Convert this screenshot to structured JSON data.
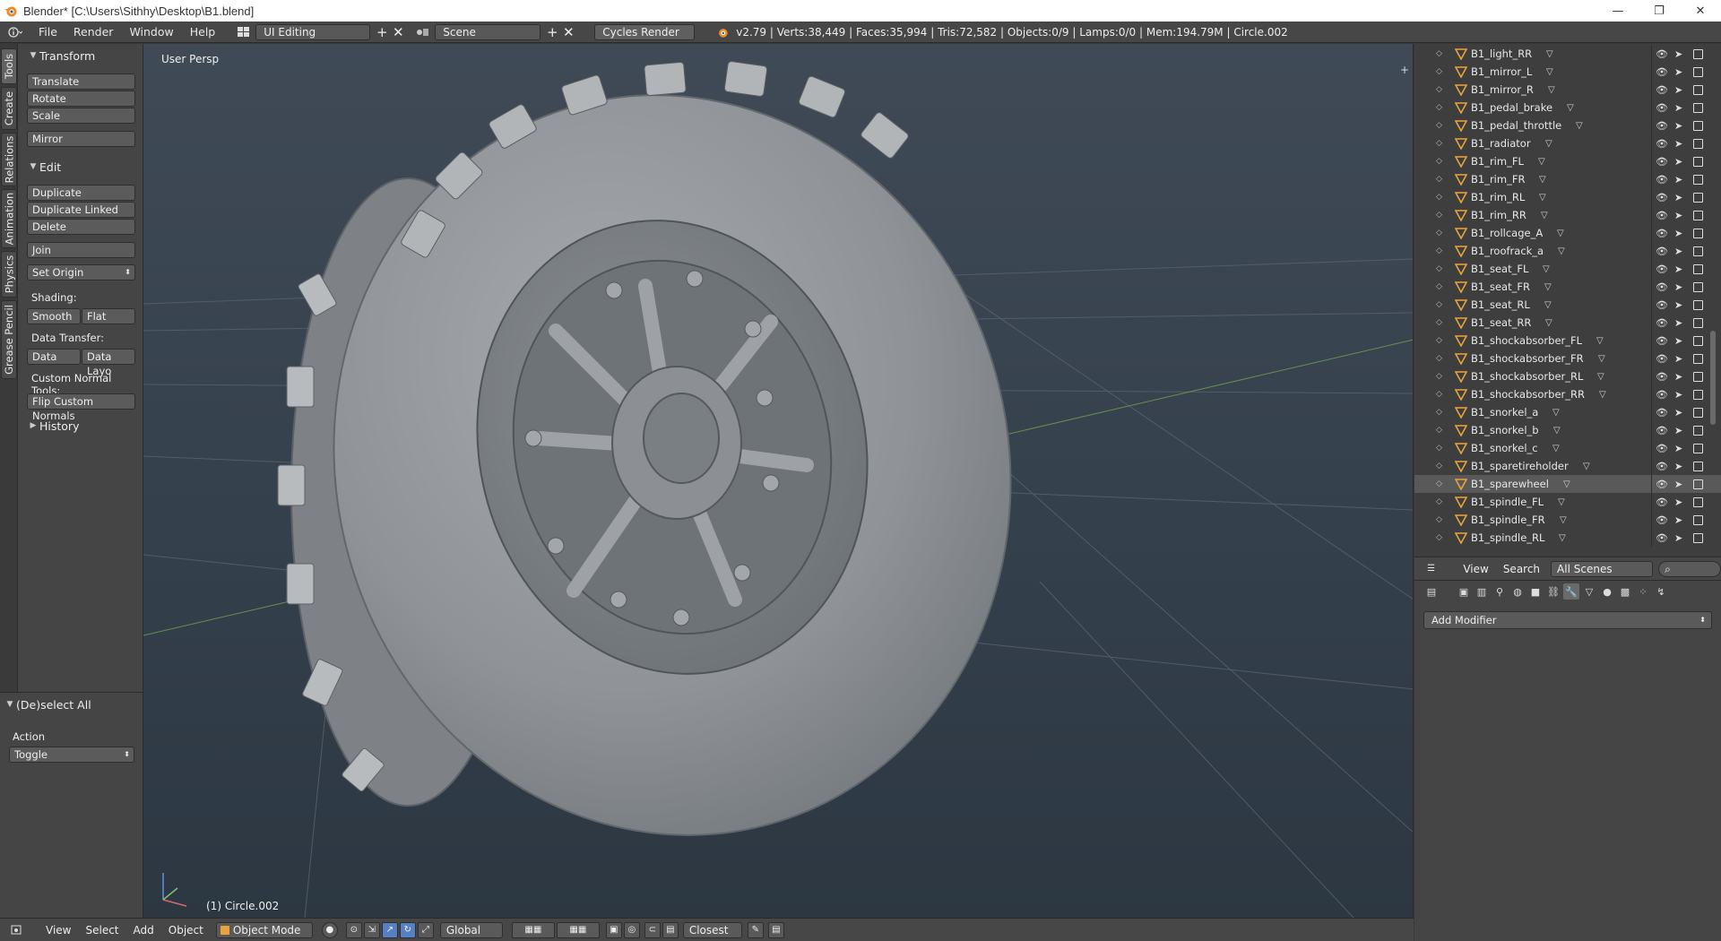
{
  "window": {
    "title": "Blender* [C:\\Users\\Sithhy\\Desktop\\B1.blend]",
    "minimize": "—",
    "maximize": "❐",
    "close": "✕"
  },
  "infobar": {
    "menus": [
      "File",
      "Render",
      "Window",
      "Help"
    ],
    "screen_layout": "UI Editing",
    "scene": "Scene",
    "render_engine": "Cycles Render",
    "stats": "v2.79 | Verts:38,449 | Faces:35,994 | Tris:72,582 | Objects:0/9 | Lamps:0/0 | Mem:194.79M | Circle.002"
  },
  "tabs": [
    "Tools",
    "Create",
    "Relations",
    "Animation",
    "Physics",
    "Grease Pencil"
  ],
  "toolshelf": {
    "transform_header": "Transform",
    "translate": "Translate",
    "rotate": "Rotate",
    "scale": "Scale",
    "mirror": "Mirror",
    "edit_header": "Edit",
    "duplicate": "Duplicate",
    "duplicate_linked": "Duplicate Linked",
    "delete": "Delete",
    "join": "Join",
    "set_origin": "Set Origin",
    "shading_label": "Shading:",
    "smooth": "Smooth",
    "flat": "Flat",
    "data_transfer_label": "Data Transfer:",
    "data": "Data",
    "data_layout": "Data Layo",
    "custom_normal_label": "Custom Normal Tools:",
    "flip_custom_normals": "Flip Custom Normals",
    "history_header": "History"
  },
  "operator_panel": {
    "header": "(De)select All",
    "action_label": "Action",
    "action_value": "Toggle"
  },
  "viewport": {
    "view_label": "User Persp",
    "object_label": "(1) Circle.002"
  },
  "vp_header": {
    "menus": [
      "View",
      "Select",
      "Add",
      "Object"
    ],
    "mode": "Object Mode",
    "orientation": "Global",
    "snap_target": "Closest"
  },
  "outliner": {
    "rows": [
      {
        "name": "B1_light_RR",
        "selected": false
      },
      {
        "name": "B1_mirror_L",
        "selected": false
      },
      {
        "name": "B1_mirror_R",
        "selected": false
      },
      {
        "name": "B1_pedal_brake",
        "selected": false
      },
      {
        "name": "B1_pedal_throttle",
        "selected": false
      },
      {
        "name": "B1_radiator",
        "selected": false
      },
      {
        "name": "B1_rim_FL",
        "selected": false
      },
      {
        "name": "B1_rim_FR",
        "selected": false
      },
      {
        "name": "B1_rim_RL",
        "selected": false
      },
      {
        "name": "B1_rim_RR",
        "selected": false
      },
      {
        "name": "B1_rollcage_A",
        "selected": false
      },
      {
        "name": "B1_roofrack_a",
        "selected": false
      },
      {
        "name": "B1_seat_FL",
        "selected": false
      },
      {
        "name": "B1_seat_FR",
        "selected": false
      },
      {
        "name": "B1_seat_RL",
        "selected": false
      },
      {
        "name": "B1_seat_RR",
        "selected": false
      },
      {
        "name": "B1_shockabsorber_FL",
        "selected": false
      },
      {
        "name": "B1_shockabsorber_FR",
        "selected": false
      },
      {
        "name": "B1_shockabsorber_RL",
        "selected": false
      },
      {
        "name": "B1_shockabsorber_RR",
        "selected": false
      },
      {
        "name": "B1_snorkel_a",
        "selected": false
      },
      {
        "name": "B1_snorkel_b",
        "selected": false
      },
      {
        "name": "B1_snorkel_c",
        "selected": false
      },
      {
        "name": "B1_sparetireholder",
        "selected": false
      },
      {
        "name": "B1_sparewheel",
        "selected": true
      },
      {
        "name": "B1_spindle_FL",
        "selected": false
      },
      {
        "name": "B1_spindle_FR",
        "selected": false
      },
      {
        "name": "B1_spindle_RL",
        "selected": false
      }
    ]
  },
  "outliner_header": {
    "view": "View",
    "search": "Search",
    "display_mode": "All Scenes"
  },
  "properties": {
    "add_modifier": "Add Modifier"
  },
  "colors": {
    "accent_orange": "#e8a33c",
    "selected_row": "#595959",
    "active_blue": "#5680c2"
  }
}
